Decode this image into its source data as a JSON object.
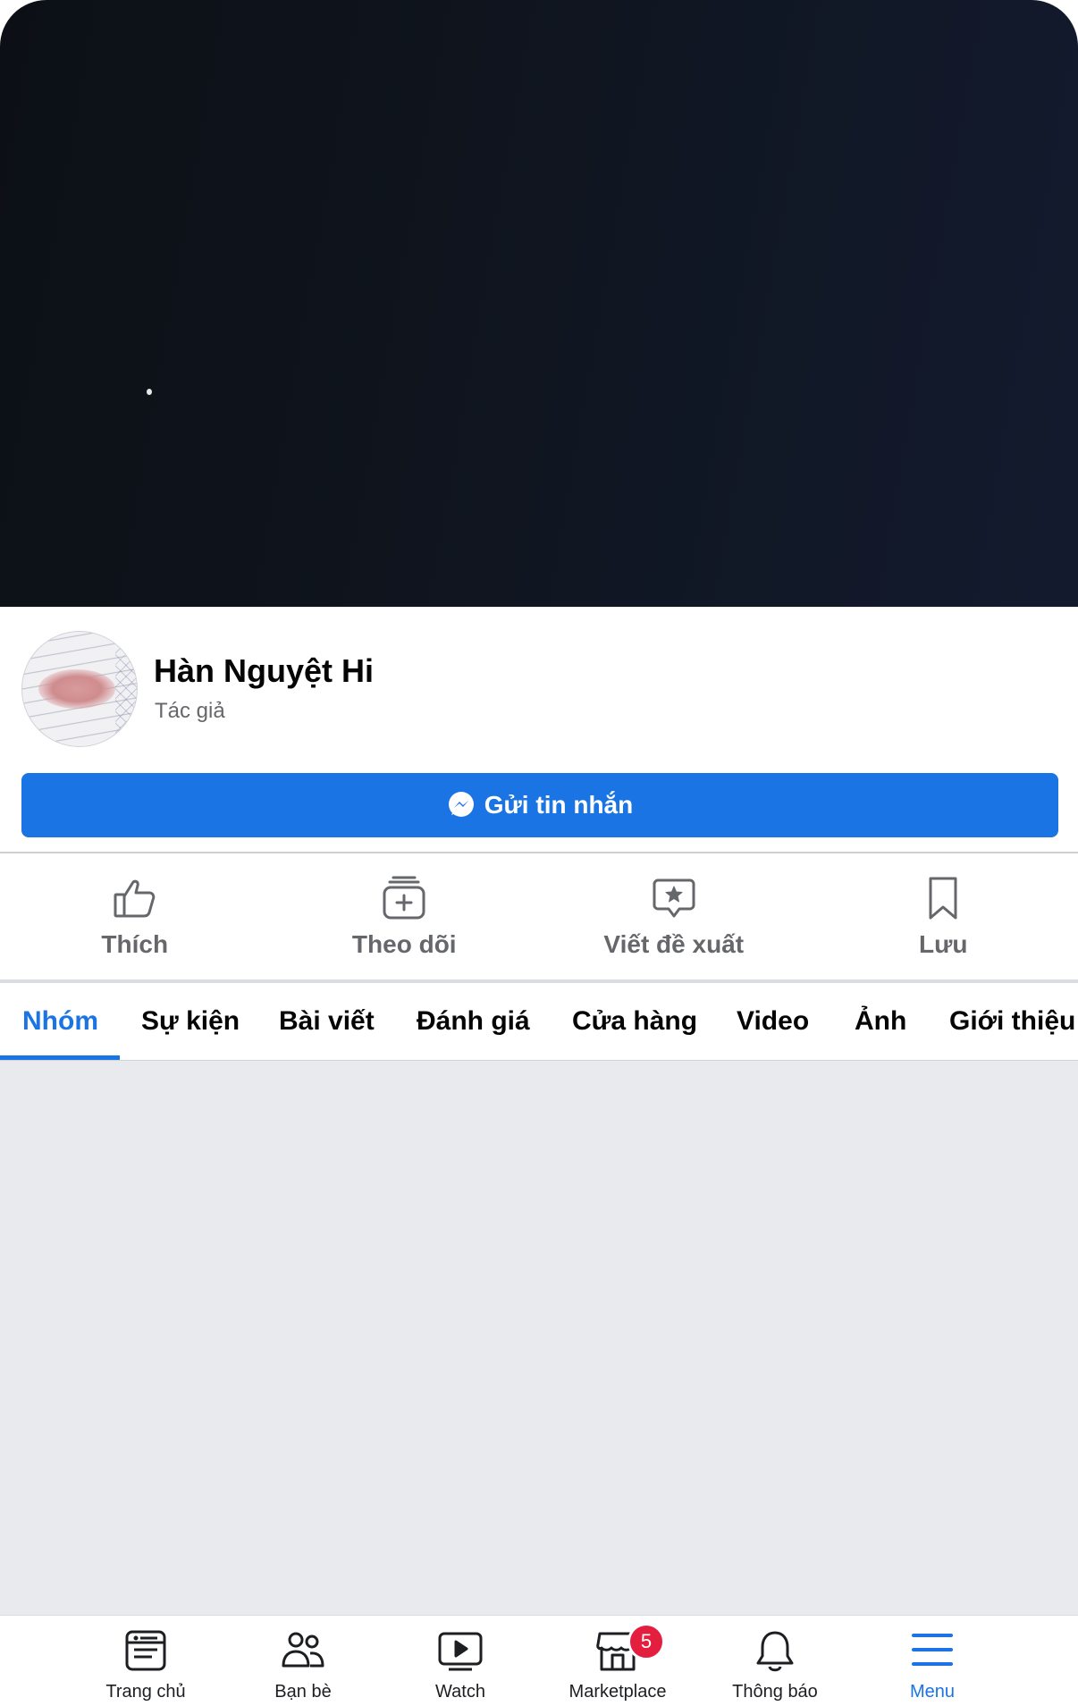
{
  "profile": {
    "name": "Hàn Nguyệt Hi",
    "role": "Tác giả"
  },
  "message_button": {
    "label": "Gửi tin nhắn",
    "icon": "messenger-icon"
  },
  "actions": [
    {
      "label": "Thích",
      "icon": "like-icon"
    },
    {
      "label": "Theo dõi",
      "icon": "follow-icon"
    },
    {
      "label": "Viết đề xuất",
      "icon": "recommend-icon"
    },
    {
      "label": "Lưu",
      "icon": "bookmark-icon"
    }
  ],
  "tabs": [
    {
      "label": "Nhóm",
      "active": true
    },
    {
      "label": "Sự kiện"
    },
    {
      "label": "Bài viết"
    },
    {
      "label": "Đánh giá"
    },
    {
      "label": "Cửa hàng"
    },
    {
      "label": "Video"
    },
    {
      "label": "Ảnh"
    },
    {
      "label": "Giới thiệu"
    }
  ],
  "bottom_nav": [
    {
      "label": "Trang chủ",
      "icon": "home-icon"
    },
    {
      "label": "Bạn bè",
      "icon": "friends-icon"
    },
    {
      "label": "Watch",
      "icon": "watch-icon"
    },
    {
      "label": "Marketplace",
      "icon": "marketplace-icon",
      "badge": "5"
    },
    {
      "label": "Thông báo",
      "icon": "bell-icon"
    },
    {
      "label": "Menu",
      "icon": "menu-icon",
      "active": true
    }
  ],
  "colors": {
    "accent": "#1b74e4",
    "badge": "#e41e3f",
    "muted": "#65676b",
    "content_bg": "#e9eaed"
  }
}
